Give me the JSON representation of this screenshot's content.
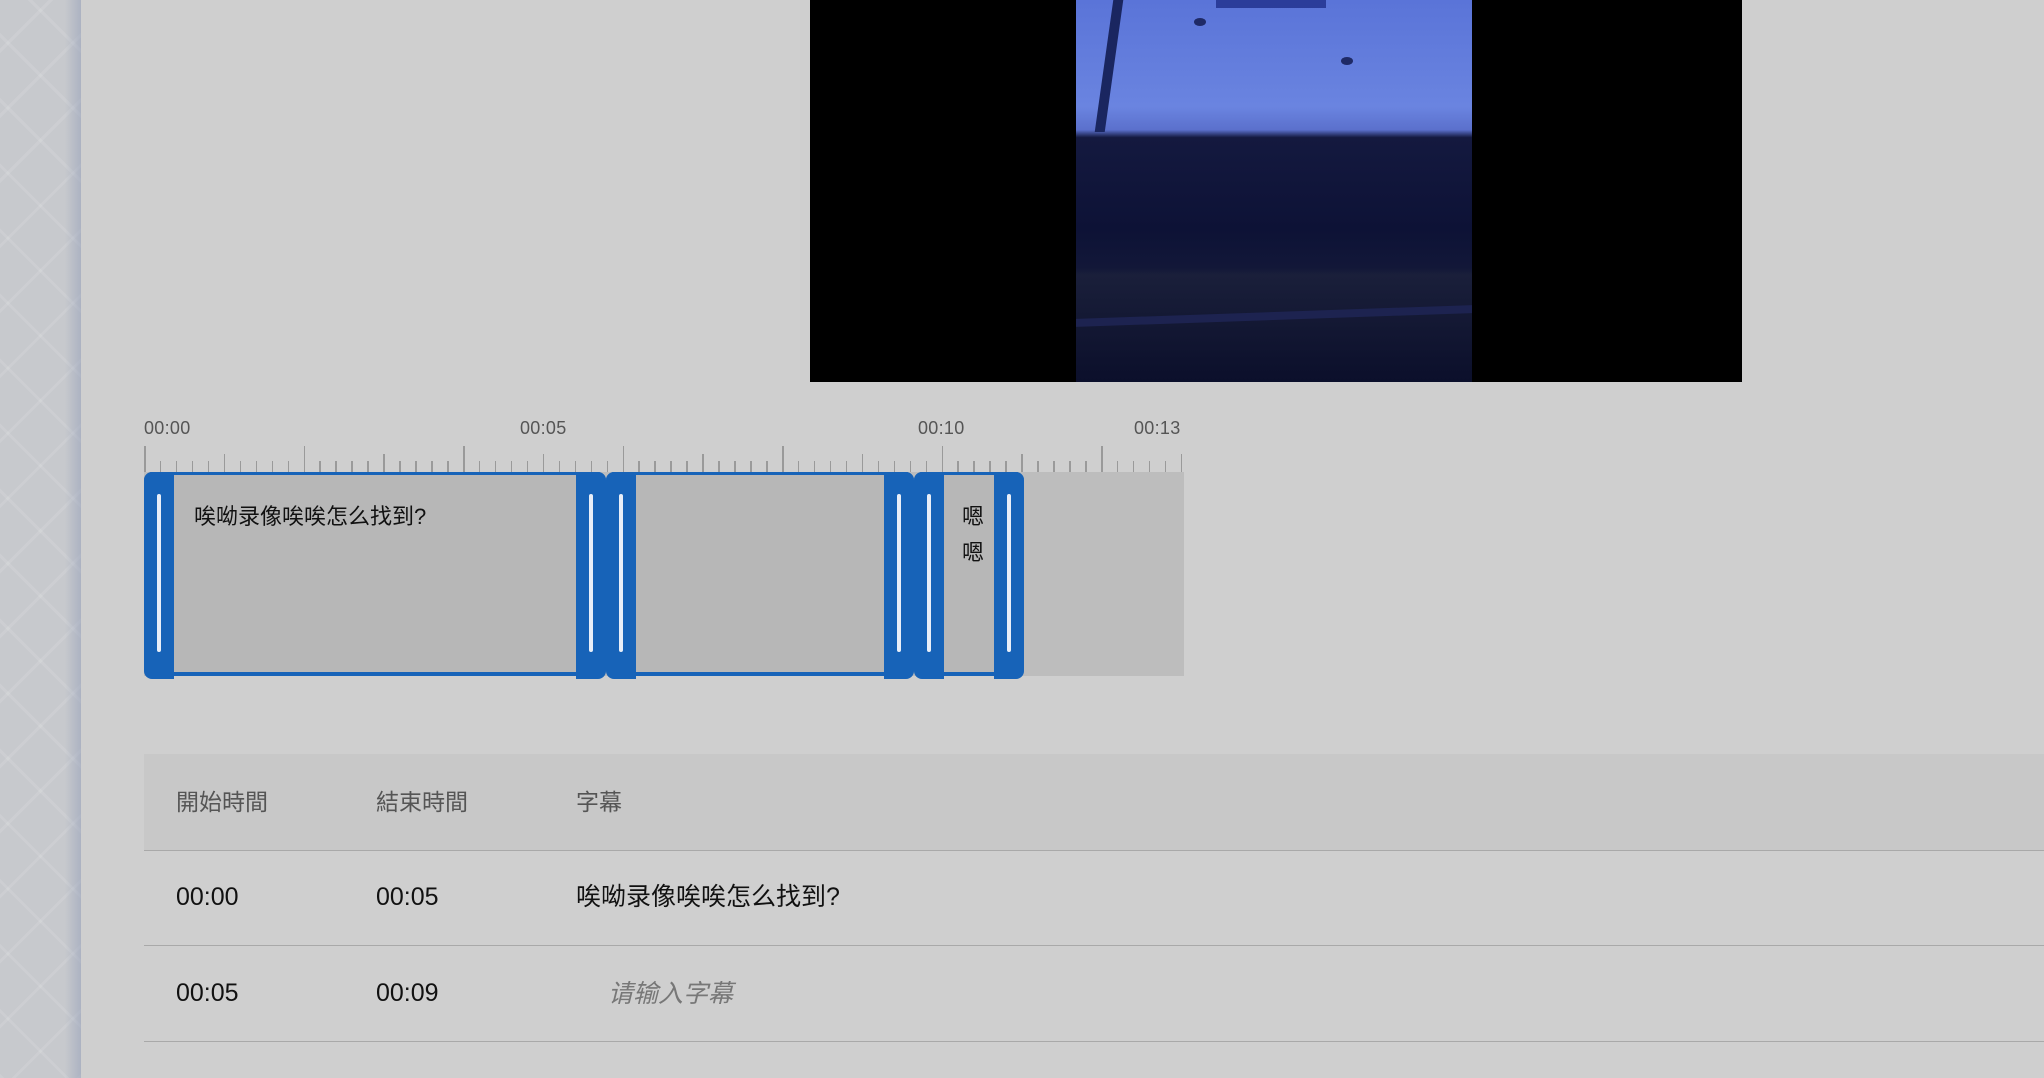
{
  "ruler": {
    "labels": [
      "00:00",
      "00:05",
      "00:10",
      "00:13"
    ]
  },
  "timeline": {
    "segments": [
      {
        "start": "00:00",
        "end": "00:05",
        "text": "唉呦录像唉唉怎么找到?"
      },
      {
        "start": "00:05",
        "end": "00:09",
        "text": ""
      },
      {
        "start": "00:09",
        "end": "00:10",
        "text": "嗯嗯"
      }
    ]
  },
  "table": {
    "headers": {
      "start": "開始時間",
      "end": "結束時間",
      "subtitle": "字幕"
    },
    "rows": [
      {
        "start": "00:00",
        "end": "00:05",
        "subtitle": "唉呦录像唉唉怎么找到?"
      },
      {
        "start": "00:05",
        "end": "00:09",
        "subtitle_value": "",
        "subtitle_placeholder": "请输入字幕"
      }
    ]
  },
  "colors": {
    "accent": "#1763b8",
    "background": "#cfcfcf"
  }
}
